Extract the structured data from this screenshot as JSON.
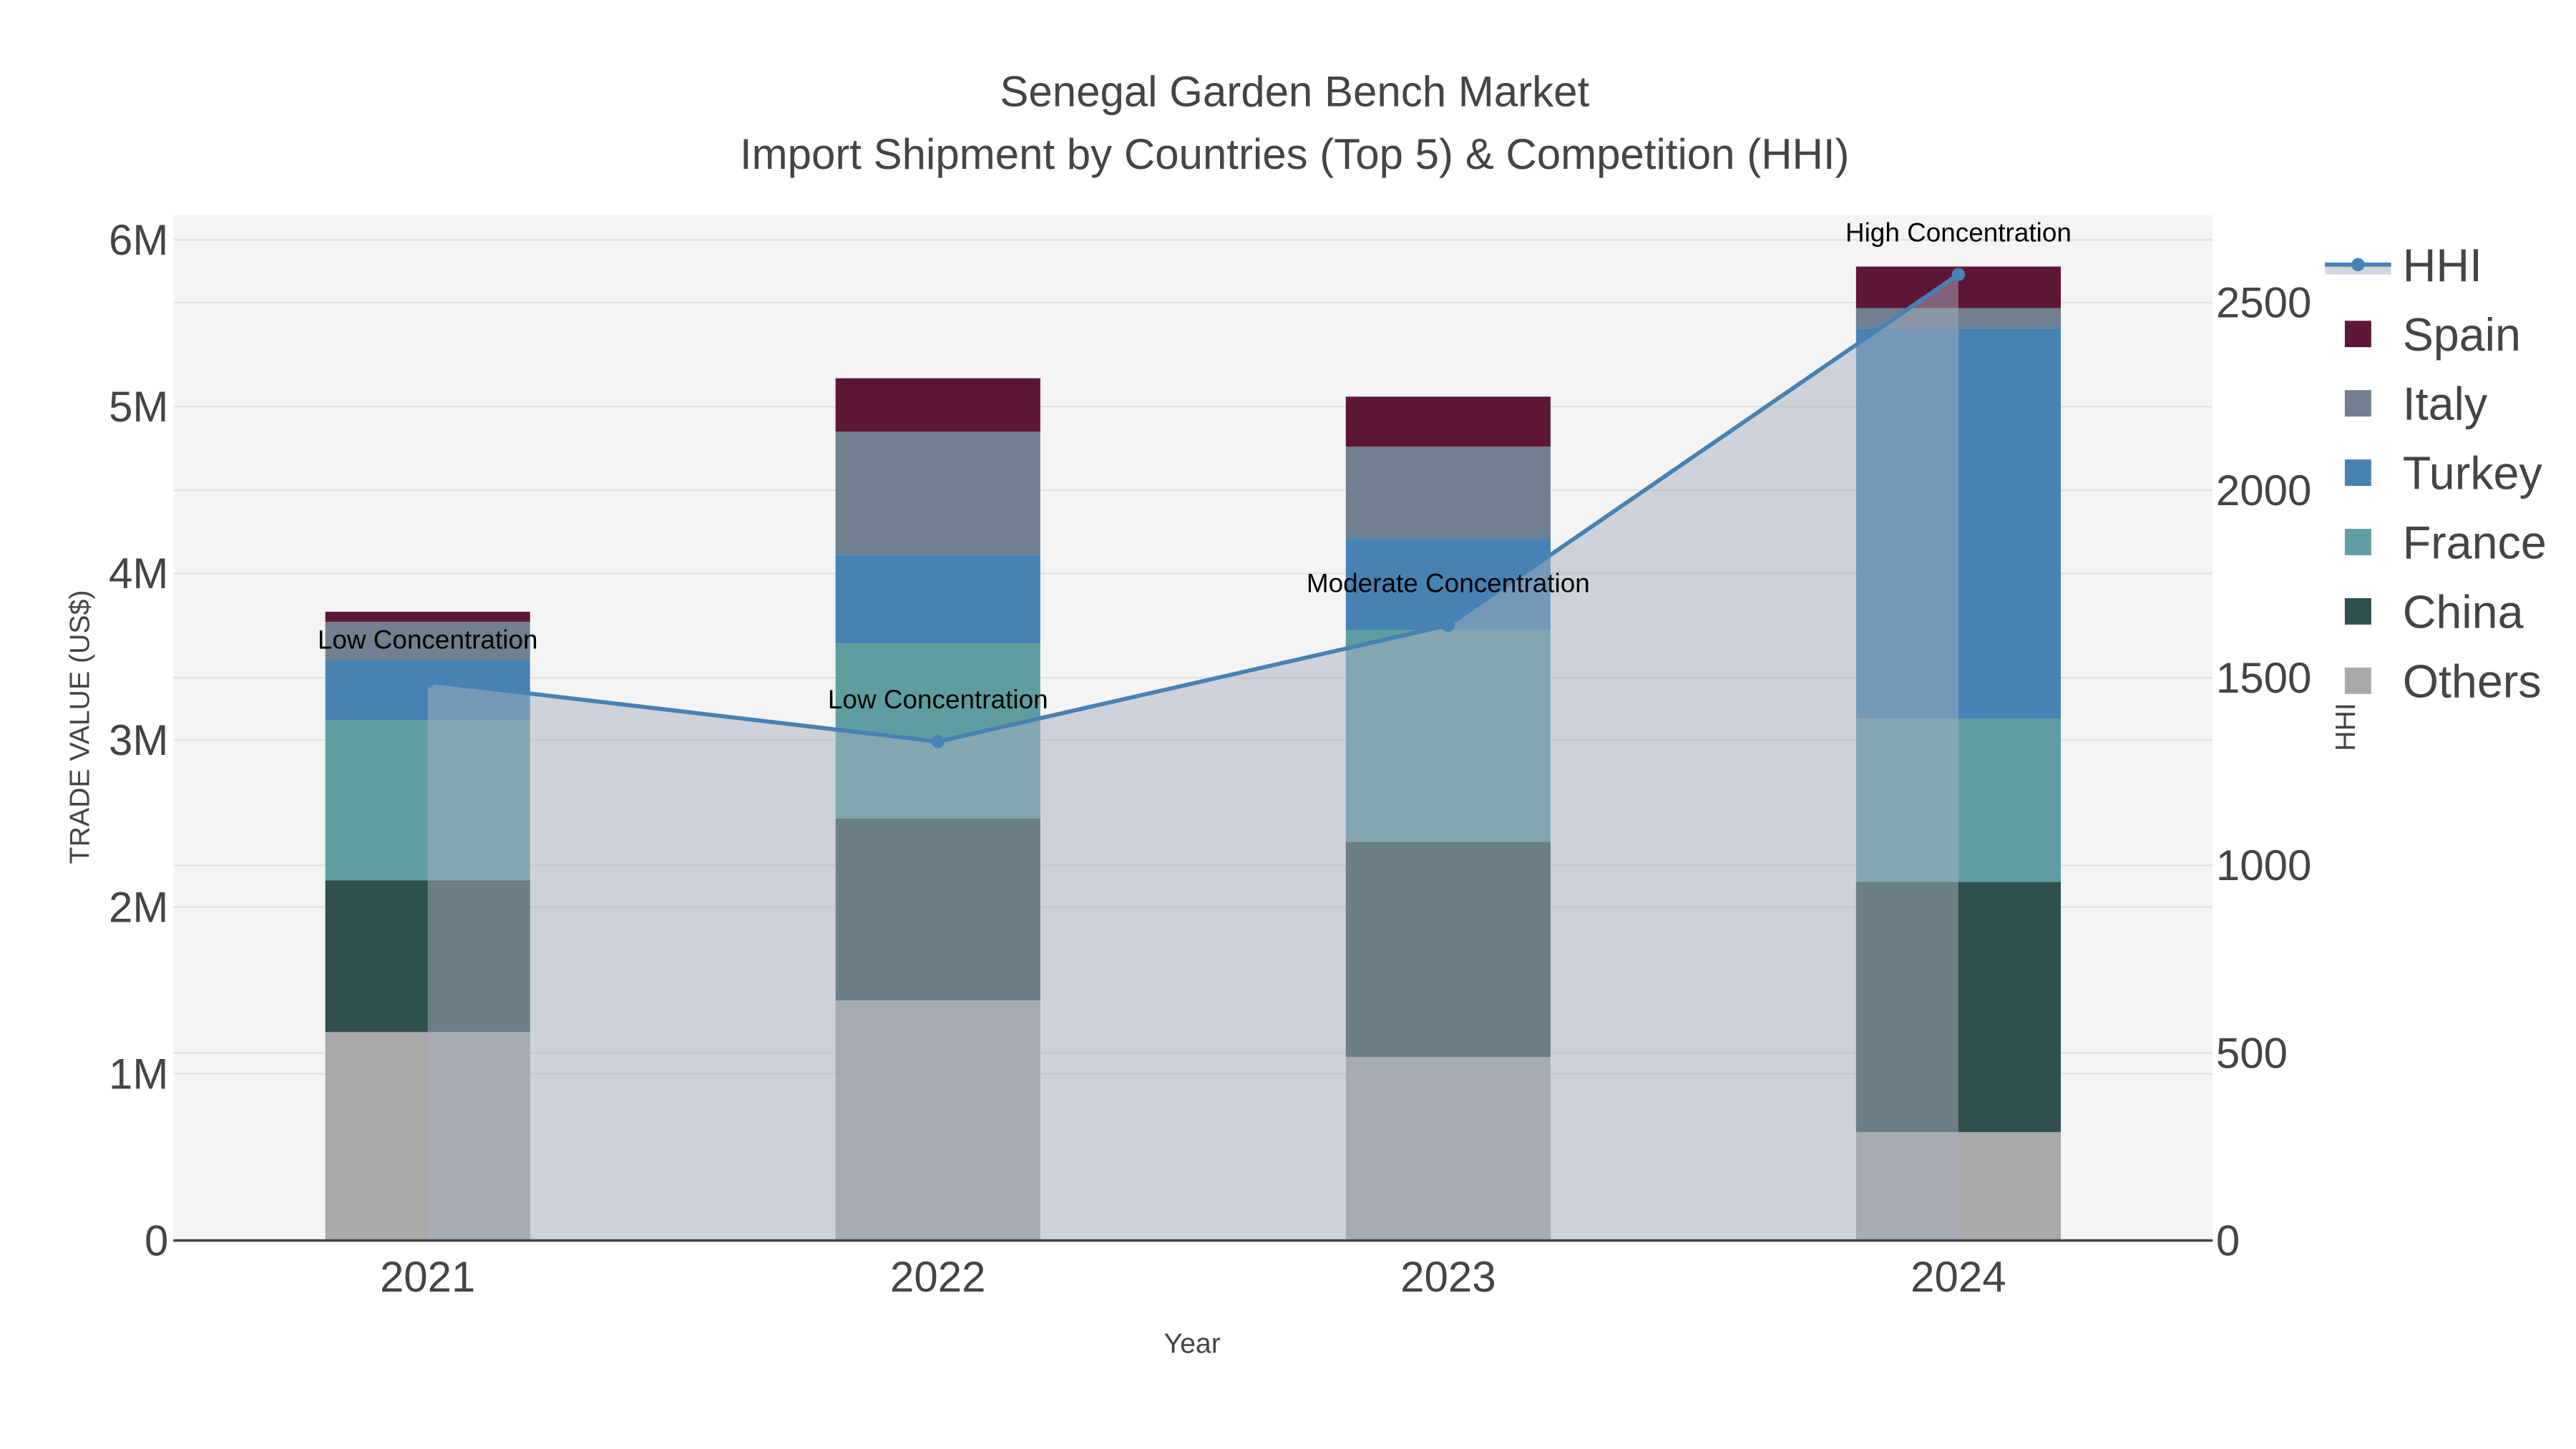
{
  "chart_data": {
    "type": "bar",
    "stacked": true,
    "title": "Senegal Garden Bench Market",
    "subtitle": "Import Shipment by Countries (Top 5) & Competition (HHI)",
    "xlabel": "Year",
    "ylabel": "TRADE VALUE (US$)",
    "y2label": "HHI",
    "categories": [
      "2021",
      "2022",
      "2023",
      "2024"
    ],
    "ylim": [
      0,
      6000000
    ],
    "yticks": [
      0,
      1000000,
      2000000,
      3000000,
      4000000,
      5000000,
      6000000
    ],
    "ytick_labels": [
      "0",
      "1M",
      "2M",
      "3M",
      "4M",
      "5M",
      "6M"
    ],
    "y2lim": [
      0,
      2650
    ],
    "y2ticks": [
      0,
      500,
      1000,
      1500,
      2000,
      2500
    ],
    "y2tick_labels": [
      "0",
      "500",
      "1000",
      "1500",
      "2000",
      "2500"
    ],
    "grid": true,
    "legend_position": "right",
    "series": [
      {
        "name": "Others",
        "color": "#a9a9a9",
        "values": [
          1250000,
          1440000,
          1100000,
          650000
        ]
      },
      {
        "name": "China",
        "color": "#2f4f4f",
        "values": [
          910000,
          1090000,
          1290000,
          1500000
        ]
      },
      {
        "name": "France",
        "color": "#5f9ea0",
        "values": [
          960000,
          1050000,
          1270000,
          980000
        ]
      },
      {
        "name": "Turkey",
        "color": "#4682b4",
        "values": [
          360000,
          530000,
          550000,
          2340000
        ]
      },
      {
        "name": "Italy",
        "color": "#708090",
        "values": [
          230000,
          740000,
          550000,
          120000
        ]
      },
      {
        "name": "Spain",
        "color": "#5f1536",
        "values": [
          60000,
          320000,
          300000,
          250000
        ]
      }
    ],
    "hhi": {
      "name": "HHI",
      "type": "line+area",
      "color": "#4682b4",
      "values": [
        1490,
        1330,
        1640,
        2575
      ],
      "annotations": [
        "Low Concentration",
        "Low Concentration",
        "Moderate Concentration",
        "High Concentration"
      ]
    },
    "legend": [
      "HHI",
      "Spain",
      "Italy",
      "Turkey",
      "France",
      "China",
      "Others"
    ]
  }
}
